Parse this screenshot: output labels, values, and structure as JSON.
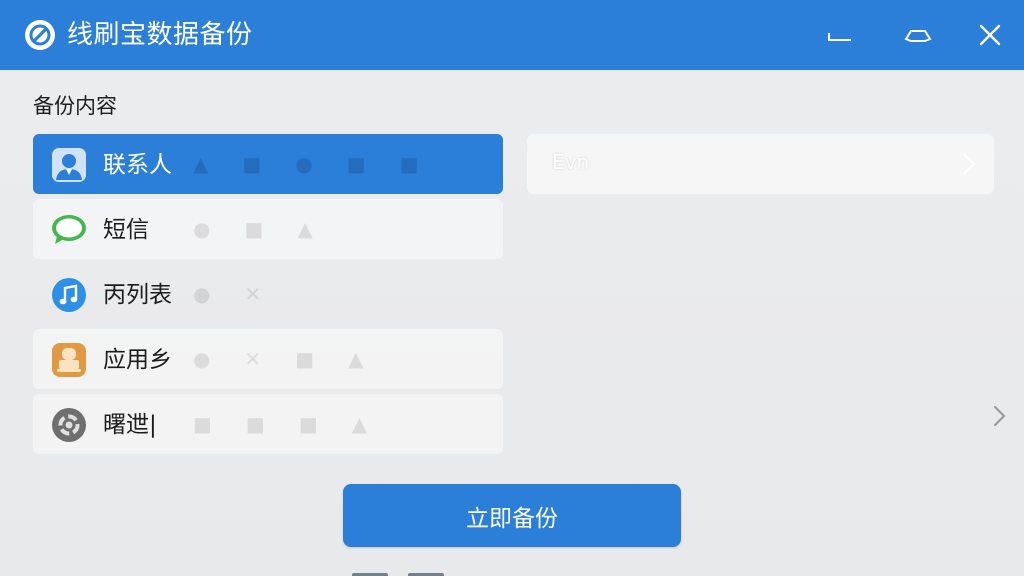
{
  "window": {
    "title": "线刷宝数据备份"
  },
  "backup": {
    "section_title": "备份内容",
    "items": [
      {
        "label": "联系人",
        "icon": "contact-icon",
        "selected": true
      },
      {
        "label": "短信",
        "icon": "message-icon",
        "selected": false
      },
      {
        "label": "丙列表",
        "icon": "music-icon",
        "selected": false
      },
      {
        "label": "应用乡",
        "icon": "app-icon",
        "selected": false
      },
      {
        "label": "曙迣|",
        "icon": "settings-icon",
        "selected": false
      }
    ],
    "detail_text": "Evn",
    "primary_button": "立即备份"
  },
  "colors": {
    "brand_blue": "#2b7fd8",
    "background": "#e8e9eb",
    "message_green": "#46b74a",
    "music_blue": "#2d8fe6",
    "app_orange": "#e09a43",
    "settings_gray": "#6f6f6f"
  }
}
